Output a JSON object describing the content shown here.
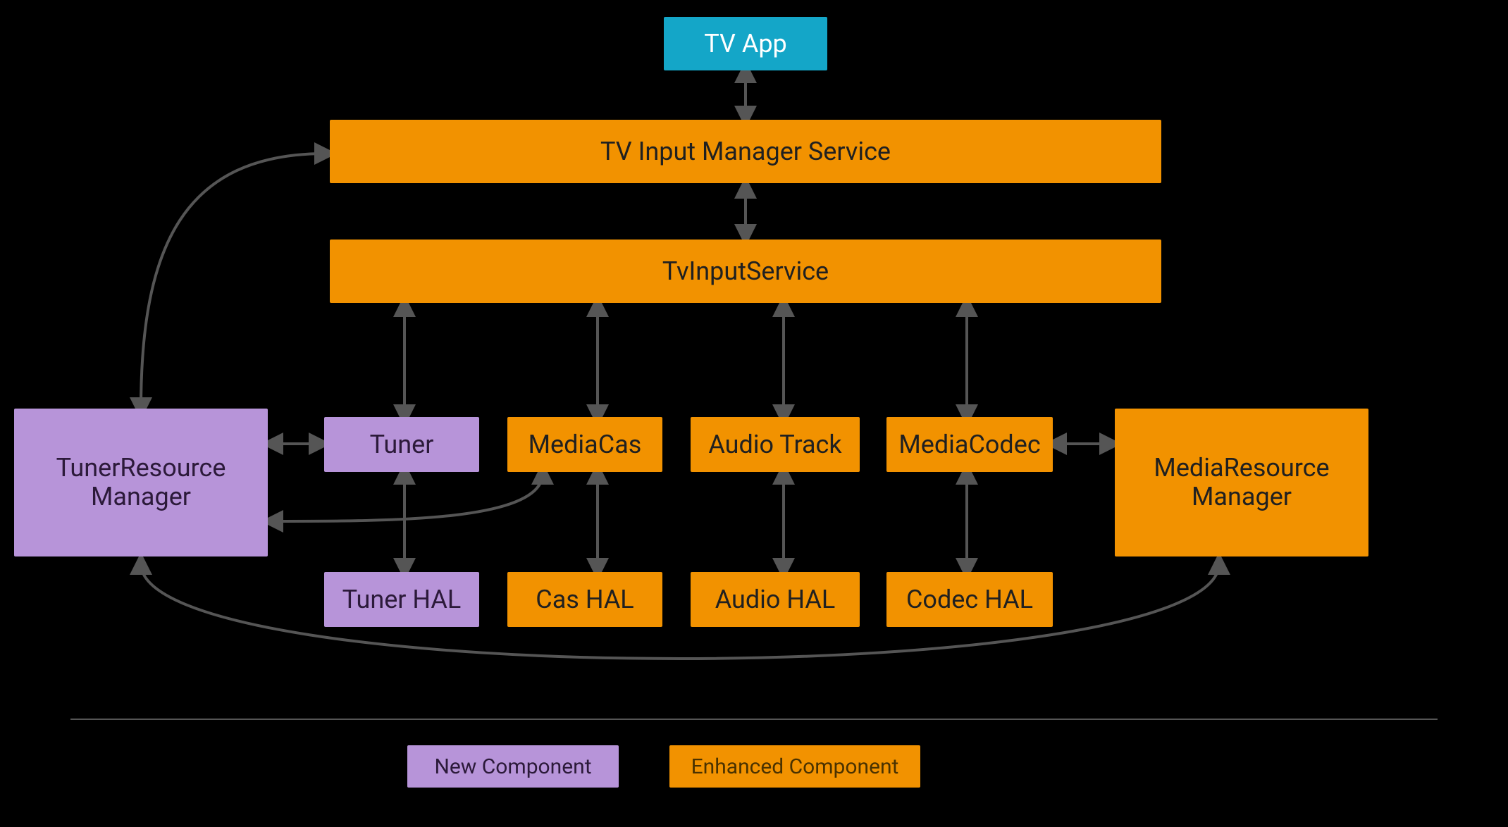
{
  "colors": {
    "cyan": "#14a6c8",
    "orange": "#f29200",
    "purple": "#b794d9",
    "arrow": "#555555"
  },
  "blocks": {
    "tv_app": "TV App",
    "tv_input_manager_service": "TV Input Manager Service",
    "tv_input_service": "TvInputService",
    "tuner_resource_manager_l1": "TunerResource",
    "tuner_resource_manager_l2": "Manager",
    "tuner": "Tuner",
    "media_cas": "MediaCas",
    "audio_track": "Audio Track",
    "media_codec": "MediaCodec",
    "media_resource_manager_l1": "MediaResource",
    "media_resource_manager_l2": "Manager",
    "tuner_hal": "Tuner HAL",
    "cas_hal": "Cas HAL",
    "audio_hal": "Audio HAL",
    "codec_hal": "Codec HAL"
  },
  "legend": {
    "new_component": "New Component",
    "enhanced_component": "Enhanced Component"
  }
}
